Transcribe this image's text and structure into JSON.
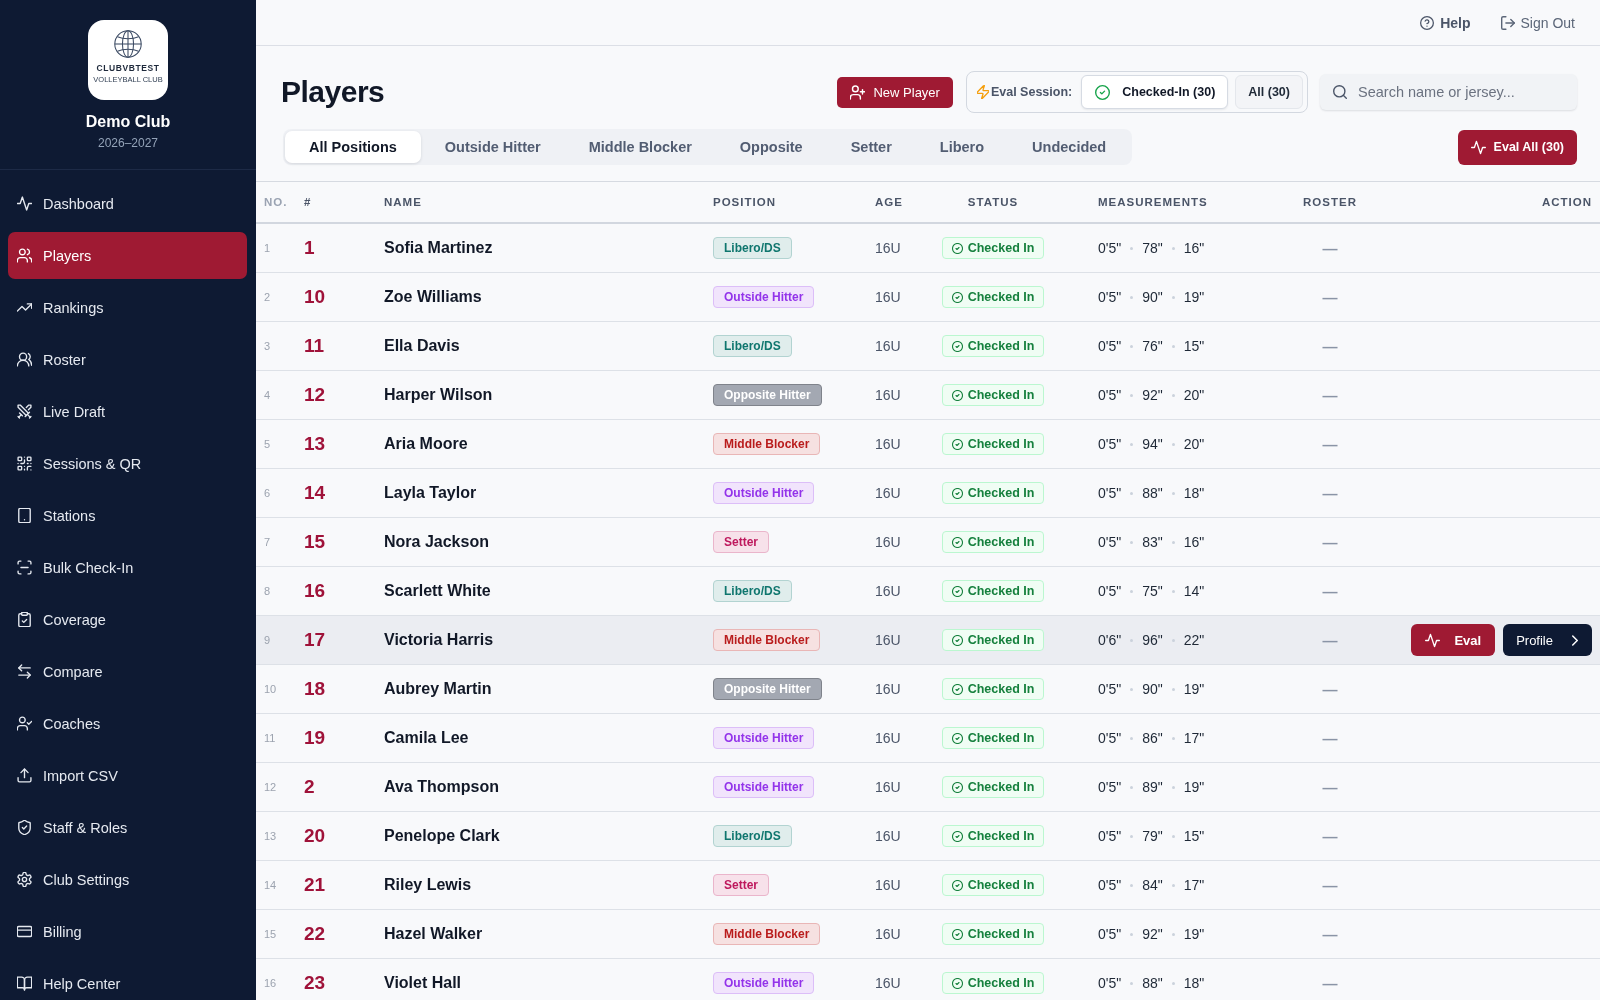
{
  "sidebar": {
    "logo": {
      "wordmark": "CLUBVBTEST",
      "tagline": "VOLLEYBALL CLUB"
    },
    "club_name": "Demo Club",
    "season": "2026–2027",
    "nav_items": [
      {
        "label": "Dashboard",
        "selected": false
      },
      {
        "label": "Players",
        "selected": true
      },
      {
        "label": "Rankings",
        "selected": false
      },
      {
        "label": "Roster",
        "selected": false
      },
      {
        "label": "Live Draft",
        "selected": false
      },
      {
        "label": "Sessions & QR",
        "selected": false
      },
      {
        "label": "Stations",
        "selected": false
      },
      {
        "label": "Bulk Check-In",
        "selected": false
      },
      {
        "label": "Coverage",
        "selected": false
      },
      {
        "label": "Compare",
        "selected": false
      },
      {
        "label": "Coaches",
        "selected": false
      },
      {
        "label": "Import CSV",
        "selected": false
      },
      {
        "label": "Staff & Roles",
        "selected": false
      },
      {
        "label": "Club Settings",
        "selected": false
      },
      {
        "label": "Billing",
        "selected": false
      },
      {
        "label": "Help Center",
        "selected": false
      }
    ]
  },
  "top_bar": {
    "links": [
      {
        "label": "Help",
        "kind": "help"
      },
      {
        "label": "Sign Out",
        "kind": "sign_out"
      }
    ]
  },
  "page_title": "Players",
  "new_player_button": "New Player",
  "eval_session": {
    "label": "Eval Session:",
    "options": [
      {
        "label": "Checked-In (30)",
        "selected": true
      },
      {
        "label": "All (30)",
        "selected": false
      }
    ]
  },
  "search": {
    "placeholder": "Search name or jersey..."
  },
  "position_tabs": [
    {
      "label": "All Positions",
      "selected": true
    },
    {
      "label": "Outside Hitter",
      "selected": false
    },
    {
      "label": "Middle Blocker",
      "selected": false
    },
    {
      "label": "Opposite",
      "selected": false
    },
    {
      "label": "Setter",
      "selected": false
    },
    {
      "label": "Libero",
      "selected": false
    },
    {
      "label": "Undecided",
      "selected": false
    }
  ],
  "eval_all_button": "Eval All (30)",
  "table": {
    "columns": [
      "NO.",
      "#",
      "NAME",
      "POSITION",
      "AGE",
      "STATUS",
      "MEASUREMENTS",
      "ROSTER",
      "ACTION"
    ],
    "rows": [
      {
        "no": "1",
        "jersey": "1",
        "name": "Sofia Martinez",
        "position": {
          "label": "Libero/DS",
          "kind": "soft",
          "color": "#0f766e"
        },
        "age": "16U",
        "status": "Checked In",
        "measurements": [
          "0'5\"",
          "78\"",
          "16\""
        ],
        "roster": "—",
        "highlighted": false
      },
      {
        "no": "2",
        "jersey": "10",
        "name": "Zoe Williams",
        "position": {
          "label": "Outside Hitter",
          "kind": "soft",
          "color": "#9333ea"
        },
        "age": "16U",
        "status": "Checked In",
        "measurements": [
          "0'5\"",
          "90\"",
          "19\""
        ],
        "roster": "—",
        "highlighted": false
      },
      {
        "no": "3",
        "jersey": "11",
        "name": "Ella Davis",
        "position": {
          "label": "Libero/DS",
          "kind": "soft",
          "color": "#0f766e"
        },
        "age": "16U",
        "status": "Checked In",
        "measurements": [
          "0'5\"",
          "76\"",
          "15\""
        ],
        "roster": "—",
        "highlighted": false
      },
      {
        "no": "4",
        "jersey": "12",
        "name": "Harper Wilson",
        "position": {
          "label": "Opposite Hitter",
          "kind": "solid",
          "color": "#a3a8b2"
        },
        "age": "16U",
        "status": "Checked In",
        "measurements": [
          "0'5\"",
          "92\"",
          "20\""
        ],
        "roster": "—",
        "highlighted": false
      },
      {
        "no": "5",
        "jersey": "13",
        "name": "Aria Moore",
        "position": {
          "label": "Middle Blocker",
          "kind": "soft",
          "color": "#b91c1c"
        },
        "age": "16U",
        "status": "Checked In",
        "measurements": [
          "0'5\"",
          "94\"",
          "20\""
        ],
        "roster": "—",
        "highlighted": false
      },
      {
        "no": "6",
        "jersey": "14",
        "name": "Layla Taylor",
        "position": {
          "label": "Outside Hitter",
          "kind": "soft",
          "color": "#9333ea"
        },
        "age": "16U",
        "status": "Checked In",
        "measurements": [
          "0'5\"",
          "88\"",
          "18\""
        ],
        "roster": "—",
        "highlighted": false
      },
      {
        "no": "7",
        "jersey": "15",
        "name": "Nora Jackson",
        "position": {
          "label": "Setter",
          "kind": "soft",
          "color": "#be185d"
        },
        "age": "16U",
        "status": "Checked In",
        "measurements": [
          "0'5\"",
          "83\"",
          "16\""
        ],
        "roster": "—",
        "highlighted": false
      },
      {
        "no": "8",
        "jersey": "16",
        "name": "Scarlett White",
        "position": {
          "label": "Libero/DS",
          "kind": "soft",
          "color": "#0f766e"
        },
        "age": "16U",
        "status": "Checked In",
        "measurements": [
          "0'5\"",
          "75\"",
          "14\""
        ],
        "roster": "—",
        "highlighted": false
      },
      {
        "no": "9",
        "jersey": "17",
        "name": "Victoria Harris",
        "position": {
          "label": "Middle Blocker",
          "kind": "soft",
          "color": "#b91c1c"
        },
        "age": "16U",
        "status": "Checked In",
        "measurements": [
          "0'6\"",
          "96\"",
          "22\""
        ],
        "roster": "—",
        "highlighted": true,
        "actions": [
          {
            "label": "Eval",
            "kind": "eval"
          },
          {
            "label": "Profile",
            "kind": "profile"
          }
        ]
      },
      {
        "no": "10",
        "jersey": "18",
        "name": "Aubrey Martin",
        "position": {
          "label": "Opposite Hitter",
          "kind": "solid",
          "color": "#a3a8b2"
        },
        "age": "16U",
        "status": "Checked In",
        "measurements": [
          "0'5\"",
          "90\"",
          "19\""
        ],
        "roster": "—",
        "highlighted": false
      },
      {
        "no": "11",
        "jersey": "19",
        "name": "Camila Lee",
        "position": {
          "label": "Outside Hitter",
          "kind": "soft",
          "color": "#9333ea"
        },
        "age": "16U",
        "status": "Checked In",
        "measurements": [
          "0'5\"",
          "86\"",
          "17\""
        ],
        "roster": "—",
        "highlighted": false
      },
      {
        "no": "12",
        "jersey": "2",
        "name": "Ava Thompson",
        "position": {
          "label": "Outside Hitter",
          "kind": "soft",
          "color": "#9333ea"
        },
        "age": "16U",
        "status": "Checked In",
        "measurements": [
          "0'5\"",
          "89\"",
          "19\""
        ],
        "roster": "—",
        "highlighted": false
      },
      {
        "no": "13",
        "jersey": "20",
        "name": "Penelope Clark",
        "position": {
          "label": "Libero/DS",
          "kind": "soft",
          "color": "#0f766e"
        },
        "age": "16U",
        "status": "Checked In",
        "measurements": [
          "0'5\"",
          "79\"",
          "15\""
        ],
        "roster": "—",
        "highlighted": false
      },
      {
        "no": "14",
        "jersey": "21",
        "name": "Riley Lewis",
        "position": {
          "label": "Setter",
          "kind": "soft",
          "color": "#be185d"
        },
        "age": "16U",
        "status": "Checked In",
        "measurements": [
          "0'5\"",
          "84\"",
          "17\""
        ],
        "roster": "—",
        "highlighted": false
      },
      {
        "no": "15",
        "jersey": "22",
        "name": "Hazel Walker",
        "position": {
          "label": "Middle Blocker",
          "kind": "soft",
          "color": "#b91c1c"
        },
        "age": "16U",
        "status": "Checked In",
        "measurements": [
          "0'5\"",
          "92\"",
          "19\""
        ],
        "roster": "—",
        "highlighted": false
      },
      {
        "no": "16",
        "jersey": "23",
        "name": "Violet Hall",
        "position": {
          "label": "Outside Hitter",
          "kind": "soft",
          "color": "#9333ea"
        },
        "age": "16U",
        "status": "Checked In",
        "measurements": [
          "0'5\"",
          "88\"",
          "18\""
        ],
        "roster": "—",
        "highlighted": false
      }
    ]
  }
}
